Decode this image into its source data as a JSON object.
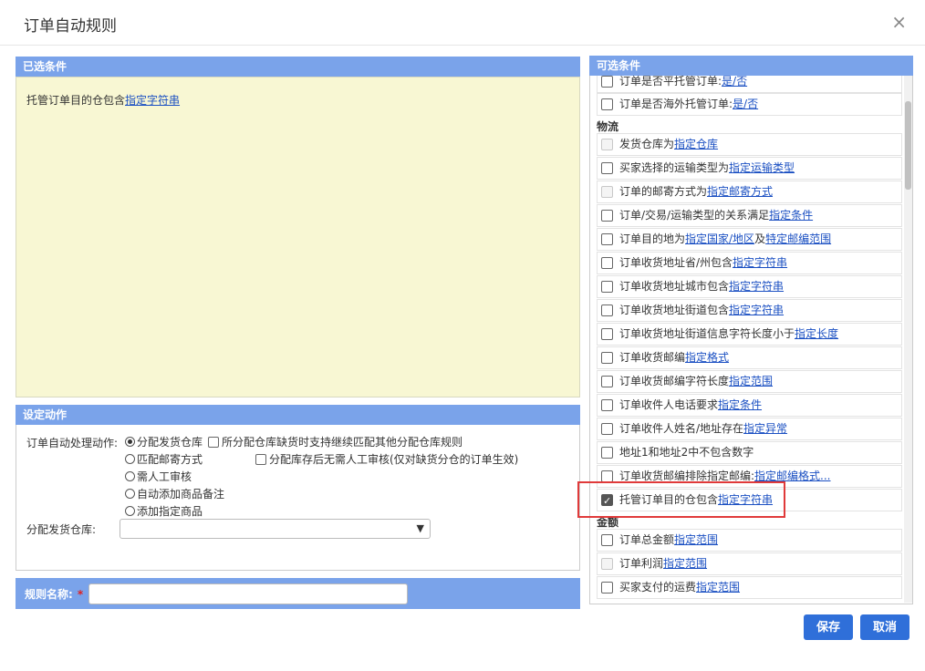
{
  "dialog": {
    "title": "订单自动规则",
    "close_glyph": "×"
  },
  "selected": {
    "header": "已选条件",
    "item_prefix": "托管订单目的仓包含",
    "item_link": "指定字符串"
  },
  "action": {
    "header": "设定动作",
    "label": "订单自动处理动作:",
    "radios": [
      "分配发货仓库",
      "匹配邮寄方式",
      "需人工审核",
      "自动添加商品备注",
      "添加指定商品"
    ],
    "checkbox1": "所分配仓库缺货时支持继续匹配其他分配仓库规则",
    "checkbox2": "分配库存后无需人工审核(仅对缺货分仓的订单生效)",
    "warehouse_label": "分配发货仓库:"
  },
  "rule_name": {
    "label": "规则名称:",
    "required": "*"
  },
  "available": {
    "header": "可选条件",
    "top_rows": [
      {
        "text": "订单是否平托管订单:",
        "link": "是/否"
      },
      {
        "text": "订单是否海外托管订单:",
        "link": "是/否"
      }
    ],
    "group_logistics": "物流",
    "logistics": [
      {
        "text": "发货仓库为",
        "link": "指定仓库",
        "disabled": true
      },
      {
        "text": "买家选择的运输类型为",
        "link": "指定运输类型"
      },
      {
        "text": "订单的邮寄方式为",
        "link": "指定邮寄方式",
        "disabled": true
      },
      {
        "text": "订单/交易/运输类型的关系满足",
        "link": "指定条件"
      },
      {
        "text": "订单目的地为",
        "link": "指定国家/地区",
        "text2": "及",
        "link2": "特定邮编范围"
      },
      {
        "text": "订单收货地址省/州包含",
        "link": "指定字符串"
      },
      {
        "text": "订单收货地址城市包含",
        "link": "指定字符串"
      },
      {
        "text": "订单收货地址街道包含",
        "link": "指定字符串"
      },
      {
        "text": "订单收货地址街道信息字符长度小于",
        "link": "指定长度"
      },
      {
        "text": "订单收货邮编",
        "link": "指定格式"
      },
      {
        "text": "订单收货邮编字符长度",
        "link": "指定范围"
      },
      {
        "text": "订单收件人电话要求",
        "link": "指定条件"
      },
      {
        "text": "订单收件人姓名/地址存在",
        "link": "指定异常"
      },
      {
        "text": "地址1和地址2中不包含数字",
        "link": ""
      },
      {
        "text": "订单收货邮编排除指定邮编:",
        "link": "指定邮编格式..."
      },
      {
        "text": "托管订单目的仓包含",
        "link": "指定字符串",
        "checked": true
      }
    ],
    "group_amount": "金额",
    "amount": [
      {
        "text": "订单总金额",
        "link": "指定范围"
      },
      {
        "text": "订单利润",
        "link": "指定范围",
        "disabled": true
      },
      {
        "text": "买家支付的运费",
        "link": "指定范围"
      }
    ]
  },
  "buttons": {
    "save": "保存",
    "cancel": "取消"
  }
}
